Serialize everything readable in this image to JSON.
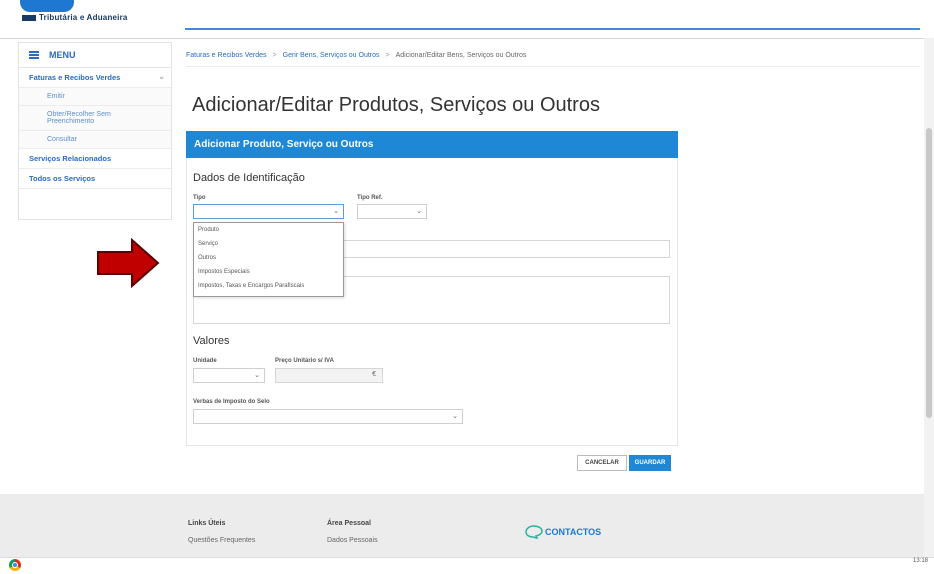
{
  "header": {
    "brand": "Tributária e Aduaneira"
  },
  "sidebar": {
    "menu_label": "MENU",
    "items": [
      {
        "label": "Faturas e Recibos Verdes"
      },
      {
        "label": "Emitir"
      },
      {
        "label": "Obter/Recolher Sem"
      },
      {
        "label": "Preenchimento"
      },
      {
        "label": "Consultar"
      },
      {
        "label": "Serviços Relacionados"
      },
      {
        "label": "Todos os Serviços"
      }
    ]
  },
  "breadcrumb": {
    "items": [
      "Faturas e Recibos Verdes",
      "Gerir Bens, Serviços ou Outros",
      "Adicionar/Editar Bens, Serviços ou Outros"
    ],
    "separator": ">"
  },
  "page": {
    "title": "Adicionar/Editar Produtos, Serviços ou Outros",
    "panel_title": "Adicionar Produto, Serviço ou Outros"
  },
  "identificacao": {
    "title": "Dados de Identificação",
    "tipo_label": "Tipo",
    "tipo_ref_label": "Tipo Ref.",
    "tipo_options": [
      "Produto",
      "Serviço",
      "Outros",
      "Impostos Especiais",
      "Impostos, Taxas e Encargos Parafiscais"
    ]
  },
  "valores": {
    "title": "Valores",
    "unidade_label": "Unidade",
    "preco_label": "Preço Unitário s/ IVA",
    "currency": "€",
    "verbas_label": "Verbas de Imposto do Selo"
  },
  "buttons": {
    "cancel": "CANCELAR",
    "save": "GUARDAR"
  },
  "footer": {
    "links_title": "Links Úteis",
    "links_item": "Questões Frequentes",
    "personal_title": "Área Pessoal",
    "personal_item": "Dados Pessoais",
    "contactos": "CONTACTOS"
  },
  "taskbar": {
    "time": "13:18"
  },
  "colors": {
    "primary": "#1e88d6",
    "link": "#2a6cc0",
    "arrow": "#c00000"
  }
}
